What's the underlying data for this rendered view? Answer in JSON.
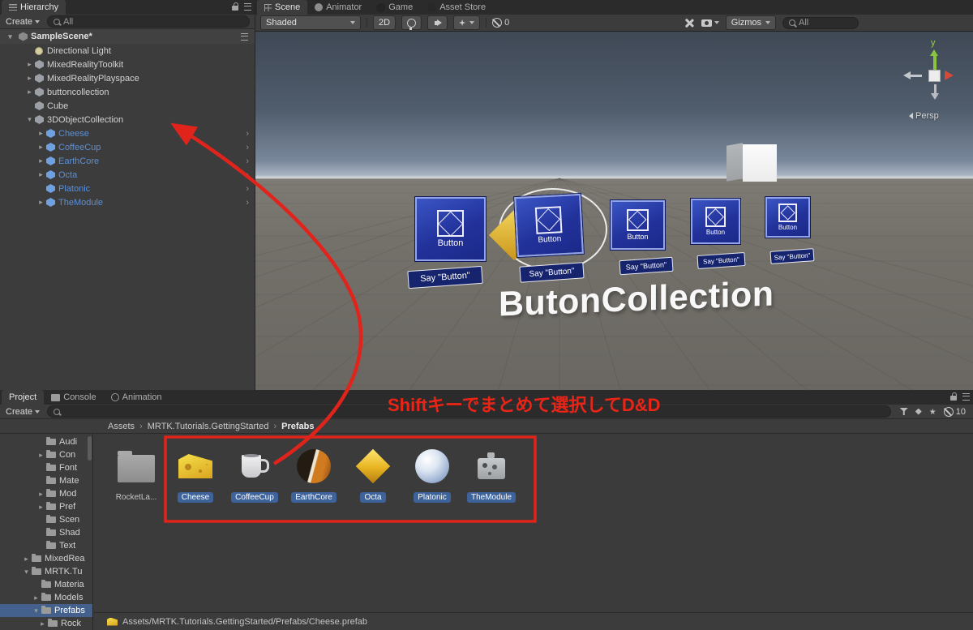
{
  "colors": {
    "selection_blue": "#3e5f96",
    "prefab_text_blue": "#5a8fd8",
    "annotation_red": "#e0241c",
    "button_plate_blue": "#22329b"
  },
  "hierarchy": {
    "tab": "Hierarchy",
    "create_button": "Create",
    "search_text": "All",
    "scene_name": "SampleScene*",
    "items": [
      {
        "label": "Directional Light",
        "indent": 1,
        "arrow": "",
        "icon": "light",
        "blue": false,
        "chevron": false
      },
      {
        "label": "MixedRealityToolkit",
        "indent": 1,
        "arrow": "right",
        "icon": "cube",
        "blue": false,
        "chevron": false
      },
      {
        "label": "MixedRealityPlayspace",
        "indent": 1,
        "arrow": "right",
        "icon": "cube",
        "blue": false,
        "chevron": false
      },
      {
        "label": "buttoncollection",
        "indent": 1,
        "arrow": "right",
        "icon": "cube",
        "blue": false,
        "chevron": false
      },
      {
        "label": "Cube",
        "indent": 1,
        "arrow": "",
        "icon": "cube",
        "blue": false,
        "chevron": false
      },
      {
        "label": "3DObjectCollection",
        "indent": 1,
        "arrow": "down",
        "icon": "cube",
        "blue": false,
        "chevron": false
      },
      {
        "label": "Cheese",
        "indent": 2,
        "arrow": "right",
        "icon": "cube",
        "blue": true,
        "chevron": true
      },
      {
        "label": "CoffeeCup",
        "indent": 2,
        "arrow": "right",
        "icon": "cube",
        "blue": true,
        "chevron": true
      },
      {
        "label": "EarthCore",
        "indent": 2,
        "arrow": "right",
        "icon": "cube",
        "blue": true,
        "chevron": true
      },
      {
        "label": "Octa",
        "indent": 2,
        "arrow": "right",
        "icon": "cube",
        "blue": true,
        "chevron": true
      },
      {
        "label": "Platonic",
        "indent": 2,
        "arrow": "",
        "icon": "cube",
        "blue": true,
        "chevron": true
      },
      {
        "label": "TheModule",
        "indent": 2,
        "arrow": "right",
        "icon": "cube",
        "blue": true,
        "chevron": true
      }
    ]
  },
  "scene": {
    "tabs": [
      {
        "label": "Scene",
        "icon": "scene-icon",
        "active": true
      },
      {
        "label": "Animator",
        "icon": "animator-icon",
        "active": false
      },
      {
        "label": "Game",
        "icon": "game-icon",
        "active": false
      },
      {
        "label": "Asset Store",
        "icon": "store-icon",
        "active": false
      }
    ],
    "toolbar": {
      "draw_mode": "Shaded",
      "mode_2d": "2D",
      "hidden_count": "0",
      "gizmos": "Gizmos",
      "search_text": "All"
    },
    "viewport": {
      "buttons": [
        {
          "label": "Button",
          "say": "Say \"Button\""
        },
        {
          "label": "Button",
          "say": "Say \"Button\""
        },
        {
          "label": "Button",
          "say": "Say \"Button\""
        },
        {
          "label": "Button",
          "say": "Say \"Button\""
        },
        {
          "label": "Button",
          "say": "Say \"Button\""
        }
      ],
      "collection_title": "ButonCollection",
      "axis_y": "y",
      "projection": "Persp"
    }
  },
  "project": {
    "tabs": [
      {
        "label": "Project",
        "icon": "",
        "active": true
      },
      {
        "label": "Console",
        "icon": "console-icon",
        "active": false
      },
      {
        "label": "Animation",
        "icon": "animation-icon",
        "active": false
      }
    ],
    "create_button": "Create",
    "hidden_packages": "10",
    "separator": "›",
    "breadcrumb": [
      "Assets",
      "MRTK.Tutorials.GettingStarted",
      "Prefabs"
    ],
    "folders": [
      {
        "label": "Audi",
        "level": "a",
        "arrow": "",
        "selected": false
      },
      {
        "label": "Con",
        "level": "a",
        "arrow": "right",
        "selected": false
      },
      {
        "label": "Font",
        "level": "a",
        "arrow": "",
        "selected": false
      },
      {
        "label": "Mate",
        "level": "a",
        "arrow": "",
        "selected": false
      },
      {
        "label": "Mod",
        "level": "a",
        "arrow": "right",
        "selected": false
      },
      {
        "label": "Pref",
        "level": "a",
        "arrow": "right",
        "selected": false
      },
      {
        "label": "Scen",
        "level": "a",
        "arrow": "",
        "selected": false
      },
      {
        "label": "Shad",
        "level": "a",
        "arrow": "",
        "selected": false
      },
      {
        "label": "Text",
        "level": "a",
        "arrow": "",
        "selected": false
      },
      {
        "label": "MixedRea",
        "level": "1",
        "arrow": "right",
        "selected": false
      },
      {
        "label": "MRTK.Tu",
        "level": "1",
        "arrow": "down",
        "selected": false
      },
      {
        "label": "Materia",
        "level": "2",
        "arrow": "",
        "selected": false
      },
      {
        "label": "Models",
        "level": "2",
        "arrow": "right",
        "selected": false
      },
      {
        "label": "Prefabs",
        "level": "2",
        "arrow": "down",
        "selected": true
      },
      {
        "label": "Rock",
        "level": "3",
        "arrow": "right",
        "selected": false
      }
    ],
    "assets": [
      {
        "label": "RocketLa...",
        "icon": "folder",
        "selected": false
      },
      {
        "label": "Cheese",
        "icon": "cheese",
        "selected": true
      },
      {
        "label": "CoffeeCup",
        "icon": "cup",
        "selected": true
      },
      {
        "label": "EarthCore",
        "icon": "earthcore",
        "selected": true
      },
      {
        "label": "Octa",
        "icon": "octa",
        "selected": true
      },
      {
        "label": "Platonic",
        "icon": "platonic",
        "selected": true
      },
      {
        "label": "TheModule",
        "icon": "module",
        "selected": true
      }
    ],
    "footer_path": "Assets/MRTK.Tutorials.GettingStarted/Prefabs/Cheese.prefab"
  },
  "annotation": {
    "text": "Shiftキーでまとめて選択してD&D"
  }
}
